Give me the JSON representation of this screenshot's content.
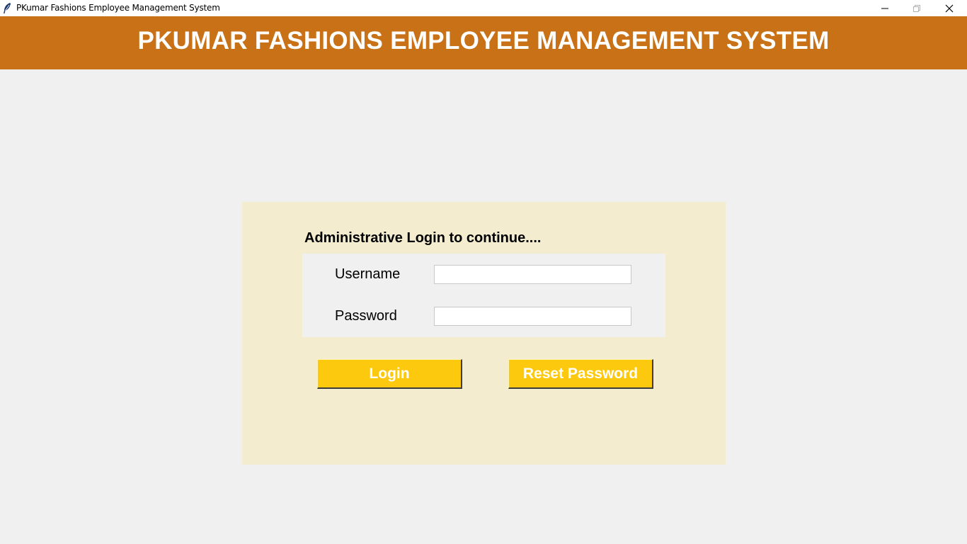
{
  "window": {
    "title": "PKumar Fashions Employee Management System",
    "controls": [
      "minimize-icon",
      "restore-icon",
      "close-icon"
    ]
  },
  "header": {
    "title": "PKUMAR FASHIONS EMPLOYEE MANAGEMENT SYSTEM",
    "background_color": "#c87116"
  },
  "login": {
    "heading": "Administrative Login to continue....",
    "panel_color": "#f3ecce",
    "username_label": "Username",
    "username_value": "",
    "password_label": "Password",
    "password_value": "",
    "login_button": "Login",
    "reset_button": "Reset Password",
    "button_color": "#fdc90f"
  }
}
